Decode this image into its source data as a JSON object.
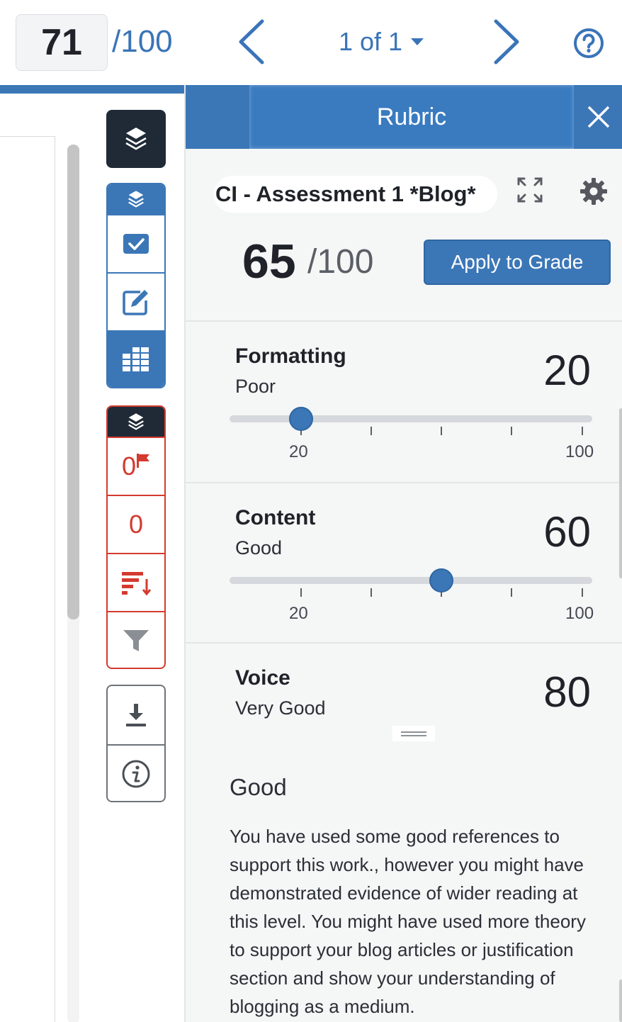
{
  "topbar": {
    "grade_value": "71",
    "grade_total": "/100",
    "page_indicator": "1 of 1",
    "accent_color": "#3a74b8"
  },
  "rubric_panel": {
    "title": "Rubric",
    "rubric_name": "CI - Assessment 1 *Blog*",
    "score": "65",
    "score_total": "/100",
    "apply_label": "Apply to Grade",
    "criteria": [
      {
        "name": "Formatting",
        "level": "Poor",
        "score": "20",
        "slider_min": "20",
        "slider_max": "100",
        "slider_value": 20
      },
      {
        "name": "Content",
        "level": "Good",
        "score": "60",
        "slider_min": "20",
        "slider_max": "100",
        "slider_value": 60
      },
      {
        "name": "Voice",
        "level": "Very Good",
        "score": "80"
      }
    ],
    "description": {
      "title": "Good",
      "text": "You have used some good references to support this work., however you might have demonstrated evidence of wider reading at this level. You might have used more theory to support your blog articles or justification section and show your understanding of blogging as a medium."
    }
  },
  "sidebar": {
    "flag_count": "0",
    "comment_count": "0",
    "icons": [
      "layers-icon",
      "checkbox-icon",
      "edit-icon",
      "grid-icon",
      "flag-icon",
      "sort-icon",
      "filter-icon",
      "download-icon",
      "info-icon"
    ]
  },
  "colors": {
    "primary": "#3b77b7",
    "dark": "#1f2a36",
    "alert": "#d43a2f"
  }
}
